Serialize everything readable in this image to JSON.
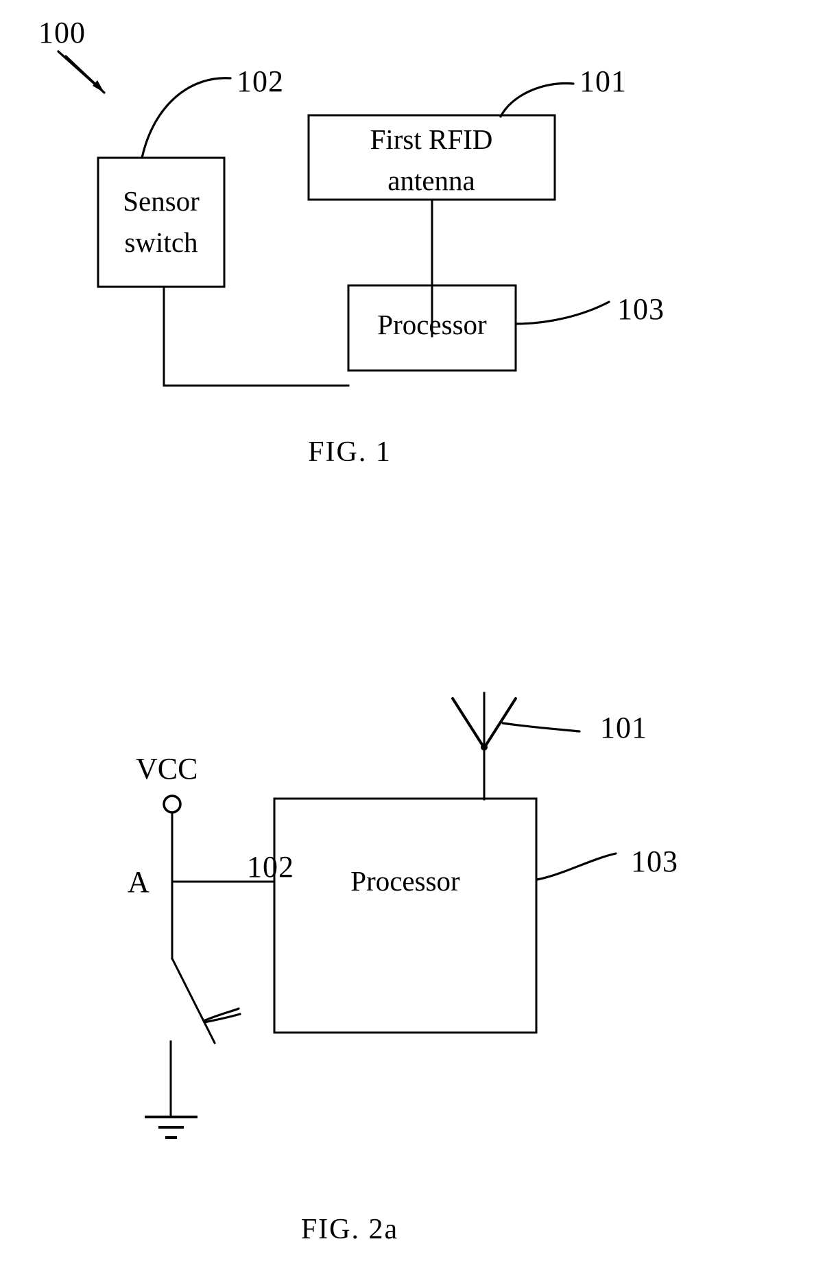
{
  "document": {
    "type": "patent-drawing-sheet",
    "background_color": "#ffffff",
    "ink_color": "#000000"
  },
  "figures": [
    {
      "id": "fig1",
      "caption": "FIG. 1",
      "system_ref": "100",
      "blocks": [
        {
          "key": "sensor_switch",
          "label_line1": "Sensor",
          "label_line2": "switch",
          "ref": "102"
        },
        {
          "key": "first_rfid_antenna",
          "label_line1": "First RFID",
          "label_line2": "antenna",
          "ref": "101"
        },
        {
          "key": "processor",
          "label_line1": "Processor",
          "label_line2": "",
          "ref": "103"
        }
      ],
      "connections": [
        {
          "from": "first_rfid_antenna",
          "to": "processor"
        },
        {
          "from": "sensor_switch",
          "to": "processor"
        }
      ]
    },
    {
      "id": "fig2a",
      "caption": "FIG. 2a",
      "nodes": [
        {
          "key": "vcc",
          "label": "VCC"
        },
        {
          "key": "node_a",
          "label": "A"
        }
      ],
      "blocks": [
        {
          "key": "processor",
          "label_line1": "Processor",
          "ref": "103"
        }
      ],
      "symbols": [
        {
          "key": "antenna",
          "ref": "101",
          "type": "dipole-antenna"
        },
        {
          "key": "sensor_switch",
          "ref": "102",
          "type": "spst-switch"
        },
        {
          "key": "ground",
          "ref": "",
          "type": "earth-ground"
        }
      ]
    }
  ],
  "fig1": {
    "ref_system": "100",
    "ref_sensor_switch": "102",
    "ref_antenna": "101",
    "ref_processor": "103",
    "sensor_switch_line1": "Sensor",
    "sensor_switch_line2": "switch",
    "antenna_line1": "First RFID",
    "antenna_line2": "antenna",
    "processor_label": "Processor",
    "caption": "FIG. 1"
  },
  "fig2a": {
    "ref_antenna": "101",
    "ref_processor": "103",
    "ref_switch": "102",
    "vcc_label": "VCC",
    "node_a_label": "A",
    "processor_label": "Processor",
    "caption": "FIG. 2a"
  }
}
